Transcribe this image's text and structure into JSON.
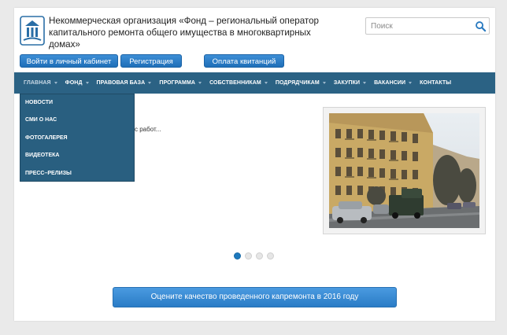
{
  "header": {
    "org_title": "Некоммерческая организация «Фонд – региональный оператор капитального ремонта общего имущества в многоквартирных домах»",
    "logo_icon": "fund-logo-icon",
    "search_placeholder": "Поиск",
    "search_icon": "search-icon"
  },
  "buttons": {
    "login": "Войти в личный кабинет",
    "register": "Регистрация",
    "payment": "Оплата квитанций"
  },
  "nav": {
    "items": [
      "ГЛАВНАЯ",
      "ФОНД",
      "ПРАВОВАЯ БАЗА",
      "ПРОГРАММА",
      "СОБСТВЕННИКАМ",
      "ПОДРЯДЧИКАМ",
      "ЗАКУПКИ",
      "ВАКАНСИИ",
      "КОНТАКТЫ"
    ]
  },
  "dropdown": {
    "items": [
      "НОВОСТИ",
      "СМИ О НАС",
      "ФОТОГАЛЕРЕЯ",
      "ВИДЕОТЕКА",
      "ПРЕСС–РЕЛИЗЫ"
    ]
  },
  "content": {
    "snippet": "с работ..."
  },
  "slider": {
    "total": 4,
    "active": 1
  },
  "survey_button": "Оцените качество проведенного капремонта в 2016 году",
  "colors": {
    "nav_bg": "#2b6284",
    "button_blue": "#1f6fb8",
    "active_dot": "#1e79bd"
  }
}
